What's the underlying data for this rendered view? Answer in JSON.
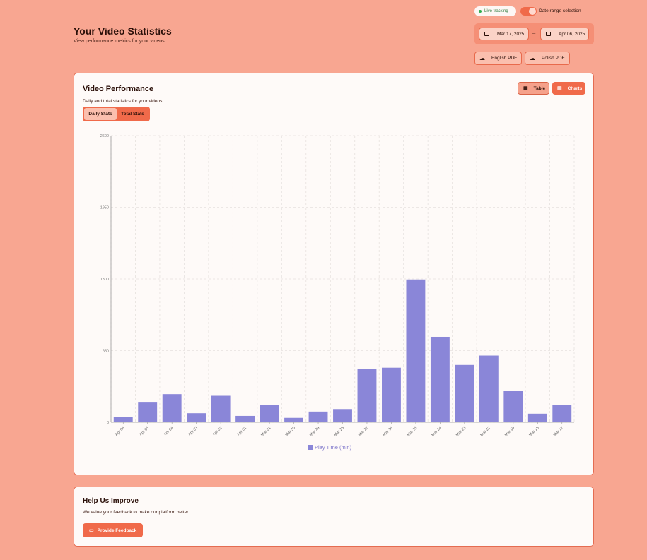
{
  "header": {
    "title": "Your Video Statistics",
    "subtitle": "View performance metrics for your videos"
  },
  "tracking": {
    "live_label": "Live tracking",
    "date_range_toggle_label": "Date range selection",
    "date_range_enabled": true
  },
  "date_range": {
    "start": "Mar 17, 2025",
    "end": "Apr 06, 2025"
  },
  "export": {
    "english_pdf": "English PDF",
    "polish_pdf": "Polish PDF"
  },
  "performance": {
    "title": "Video Performance",
    "subtitle": "Daily and total statistics for your videos",
    "view_table": "Table",
    "view_charts": "Charts",
    "tab_daily": "Daily Stats",
    "tab_total": "Total Stats"
  },
  "chart_data": {
    "type": "bar",
    "categories": [
      "Apr 06",
      "Apr 05",
      "Apr 04",
      "Apr 03",
      "Apr 02",
      "Apr 01",
      "Mar 31",
      "Mar 30",
      "Mar 29",
      "Mar 28",
      "Mar 27",
      "Mar 26",
      "Mar 25",
      "Mar 24",
      "Mar 23",
      "Mar 22",
      "Mar 19",
      "Mar 18",
      "Mar 17"
    ],
    "series": [
      {
        "name": "Play Time (min)",
        "values": [
          50,
          185,
          255,
          82,
          240,
          58,
          160,
          40,
          97,
          120,
          485,
          495,
          1295,
          775,
          520,
          605,
          285,
          78,
          160
        ]
      }
    ],
    "yticks": [
      "0",
      "650",
      "1300",
      "1950",
      "2600"
    ],
    "ylim": [
      0,
      2600
    ],
    "grid": true,
    "legend": "bottom",
    "bar_color": "#8a86d8"
  },
  "feedback": {
    "title": "Help Us Improve",
    "subtitle": "We value your feedback to make our platform better",
    "button": "Provide Feedback"
  },
  "colors": {
    "background": "#f8a691",
    "accent": "#f06a4a",
    "card": "#fefaf8"
  }
}
